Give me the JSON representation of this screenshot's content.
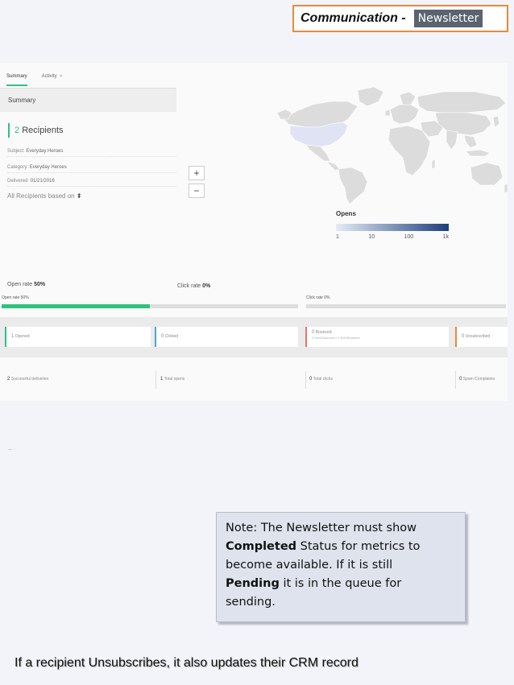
{
  "header": {
    "title": "Communication -",
    "badge": "Newsletter"
  },
  "tabs": [
    {
      "label": "Summary",
      "active": true
    },
    {
      "label": "Activity",
      "active": false
    }
  ],
  "summary": {
    "header": "Summary",
    "recipients_count": "2",
    "recipients_label": "Recipients",
    "subject_label": "Subject:",
    "subject_value": "Everyday Heroes",
    "category_label": "Category:",
    "category_value": "Everyday Heroes",
    "delivered_label": "Delivered:",
    "delivered_value": "01/21/2016",
    "based_on": "All Recipients based on",
    "based_on_icon": "sort-icon"
  },
  "zoom": {
    "plus": "+",
    "minus": "−"
  },
  "legend": {
    "title": "Opens",
    "ticks": [
      "1",
      "10",
      "100",
      "1k"
    ],
    "color_low": "#e6ecf7",
    "color_high": "#1c3f7a"
  },
  "rates": {
    "open_label": "Open rate",
    "open_value": "50%",
    "click_label": "Click rate",
    "click_value": "0%",
    "open_fraction": 0.5,
    "click_fraction": 0.0,
    "bar_color": "#2ec27e"
  },
  "stats": [
    {
      "num": "1",
      "label": "Opened",
      "sub": "",
      "color": "#2ec27e"
    },
    {
      "num": "0",
      "label": "Clicked",
      "sub": "",
      "color": "#4aa3df"
    },
    {
      "num": "0",
      "label": "Bounced",
      "sub": "0 Hard Bounced / 0 Soft Bounced",
      "color": "#e8736b"
    },
    {
      "num": "0",
      "label": "Unsubscribed",
      "sub": "",
      "color": "#e8893c"
    }
  ],
  "deliveries": [
    {
      "num": "2",
      "label": "Successful deliveries"
    },
    {
      "num": "1",
      "label": "Total opens"
    },
    {
      "num": "0",
      "label": "Total clicks"
    },
    {
      "num": "0",
      "label": "Spam Complaints"
    }
  ],
  "tiny_mark": "— ·",
  "note": {
    "line1": "Note: The Newsletter must show",
    "bold1": "Completed",
    "line2_rest": " Status for metrics to",
    "line3": "become available. If it is still",
    "bold2": "Pending",
    "line4_rest": " it is in the queue for",
    "line5": "sending."
  },
  "footer": "If a recipient Unsubscribes, it also updates their CRM record"
}
